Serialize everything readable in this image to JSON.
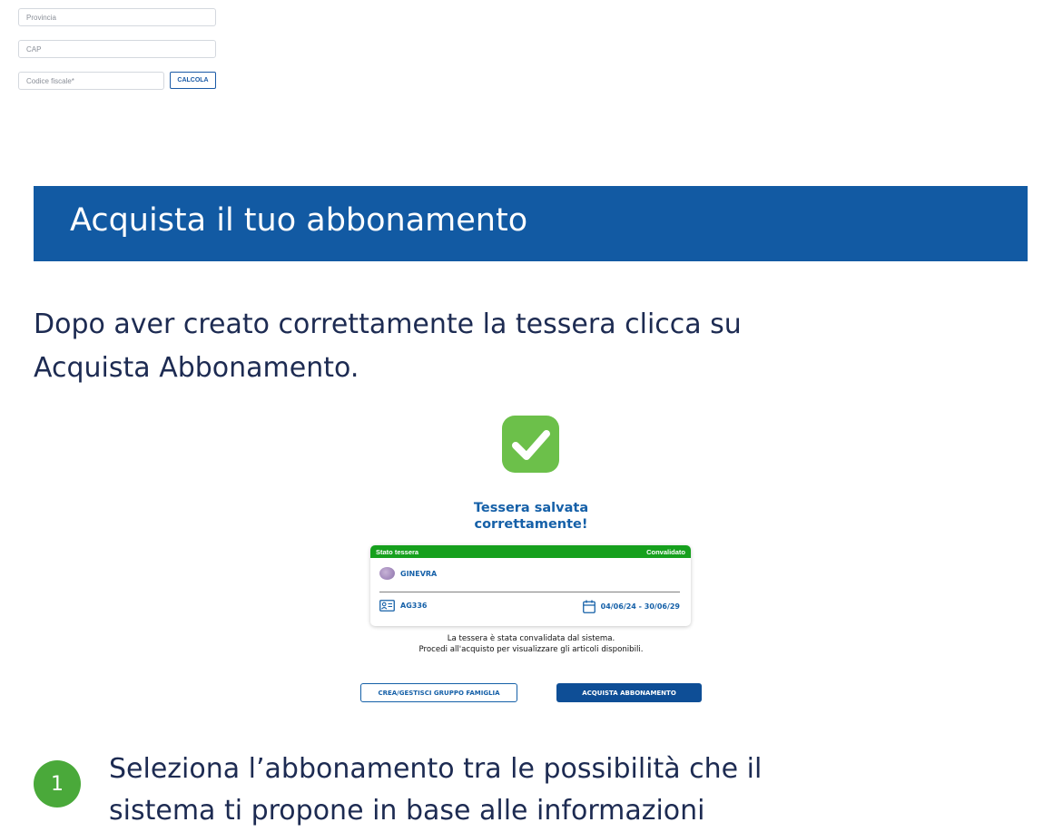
{
  "form": {
    "provincia_placeholder": "Provincia",
    "cap_placeholder": "CAP",
    "codice_fiscale_placeholder": "Codice fiscale*",
    "calcola_label": "CALCOLA"
  },
  "banner": {
    "title": "Acquista il tuo abbonamento"
  },
  "intro": {
    "text": "Dopo aver creato correttamente la tessera clicca su Acquista Abbonamento."
  },
  "confirmation": {
    "icon": "check-icon",
    "title_line1": "Tessera salvata",
    "title_line2": "correttamente!",
    "card": {
      "header_left": "Stato tessera",
      "header_right": "Convalidato",
      "name": "GINEVRA",
      "card_id": "AG336",
      "validity": "04/06/24 - 30/06/29"
    },
    "message_line1": "La tessera è stata convalidata dal sistema.",
    "message_line2": "Procedi all'acquisto per visualizzare gli articoli disponibili.",
    "family_button": "CREA/GESTISCI GRUPPO FAMIGLIA",
    "buy_button": "ACQUISTA ABBONAMENTO"
  },
  "step": {
    "number": "1",
    "text": "Seleziona l’abbonamento tra le possibilità che il sistema ti propone in base alle informazioni"
  },
  "colors": {
    "banner": "#125aa3",
    "primary_text": "#1560a8",
    "status_green": "#16a01d",
    "check_green": "#6cc04a",
    "step_green": "#4aa93a"
  }
}
